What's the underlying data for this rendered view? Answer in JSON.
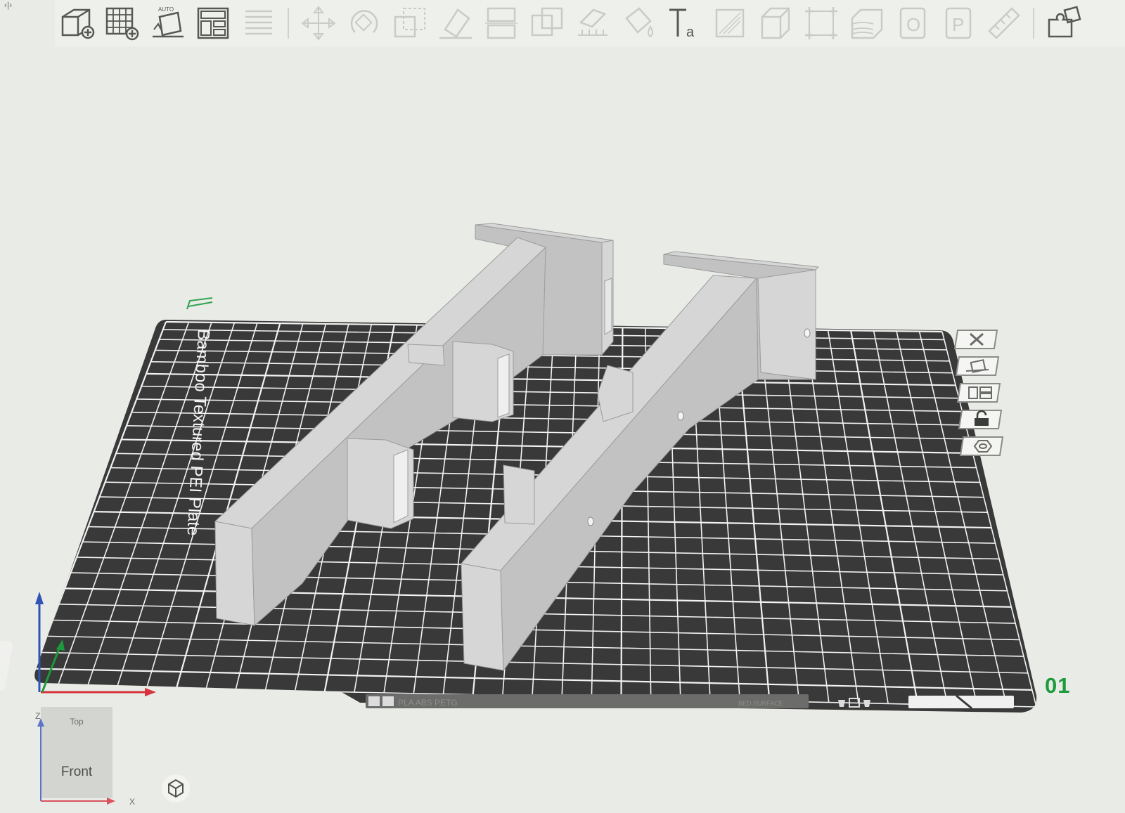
{
  "toolbar": {
    "buttons": [
      {
        "name": "add-object-button",
        "icon": "cube-plus-icon",
        "enabled": true
      },
      {
        "name": "add-plate-button",
        "icon": "grid-plus-icon",
        "enabled": true
      },
      {
        "name": "auto-orient-button",
        "icon": "auto-orient-icon",
        "label": "AUTO",
        "enabled": true
      },
      {
        "name": "arrange-button",
        "icon": "arrange-layout-icon",
        "enabled": true
      },
      {
        "name": "split-plates-button",
        "icon": "lines-icon",
        "enabled": false
      },
      {
        "name": "move-button",
        "icon": "move-icon",
        "enabled": false
      },
      {
        "name": "rotate-button",
        "icon": "rotate-icon",
        "enabled": false
      },
      {
        "name": "scale-button",
        "icon": "scale-icon",
        "enabled": false
      },
      {
        "name": "lay-on-face-button",
        "icon": "lay-on-face-icon",
        "enabled": false
      },
      {
        "name": "cut-button",
        "icon": "cut-icon",
        "enabled": false
      },
      {
        "name": "boolean-button",
        "icon": "boolean-icon",
        "enabled": false
      },
      {
        "name": "support-paint-button",
        "icon": "support-paint-icon",
        "enabled": false
      },
      {
        "name": "color-paint-button",
        "icon": "color-paint-icon",
        "enabled": false
      },
      {
        "name": "text-button",
        "icon": "text-icon",
        "label": "Ta",
        "enabled": true
      },
      {
        "name": "seam-paint-button",
        "icon": "seam-icon",
        "enabled": false
      },
      {
        "name": "assembly-button",
        "icon": "assembly-cube-icon",
        "enabled": false
      },
      {
        "name": "measure-corners-button",
        "icon": "measure-corners-icon",
        "enabled": false
      },
      {
        "name": "variable-layer-button",
        "icon": "variable-layer-icon",
        "enabled": false
      },
      {
        "name": "brim-ears-button",
        "icon": "brim-ears-icon",
        "enabled": false
      },
      {
        "name": "fuzzy-skin-button",
        "icon": "fuzzy-skin-icon",
        "enabled": false
      },
      {
        "name": "ruler-button",
        "icon": "ruler-icon",
        "enabled": false
      },
      {
        "name": "explode-button",
        "icon": "explode-puzzle-icon",
        "enabled": true
      }
    ]
  },
  "plate": {
    "label": "Bamboo Textured PEI Plate",
    "number": "01",
    "filament_text": "PLA ABS PETG",
    "status_text": "BED SURFACE"
  },
  "view_cube": {
    "top_label": "Top",
    "front_label": "Front",
    "axis_z": "Z",
    "axis_x": "X"
  },
  "colors": {
    "background": "#e9ebe6",
    "plate": "#383938",
    "grid": "#f2f2f2",
    "object_light": "#d6d6d6",
    "object_mid": "#c2c2c2",
    "object_dark": "#a9a9a9",
    "accent_green": "#1d9a3c",
    "axis_red": "#d6333c",
    "axis_blue": "#2f54b5"
  }
}
